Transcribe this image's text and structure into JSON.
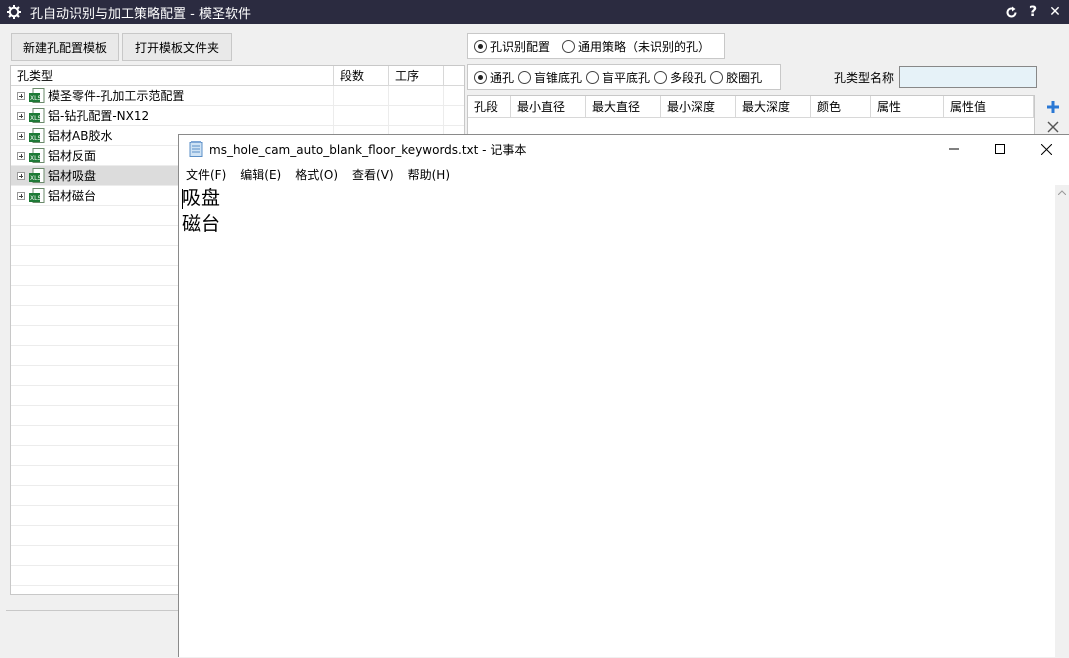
{
  "app": {
    "title": "孔自动识别与加工策略配置 - 模圣软件",
    "buttons": {
      "new_template": "新建孔配置模板",
      "open_folder": "打开模板文件夹"
    },
    "tree": {
      "headers": [
        "孔类型",
        "段数",
        "工序"
      ],
      "items": [
        {
          "label": "模圣零件-孔加工示范配置"
        },
        {
          "label": "铝-钻孔配置-NX12"
        },
        {
          "label": "铝材AB胶水"
        },
        {
          "label": "铝材反面"
        },
        {
          "label": "铝材吸盘",
          "selected": true
        },
        {
          "label": "铝材磁台"
        }
      ]
    },
    "mode": {
      "options": [
        "孔识别配置",
        "通用策略（未识别的孔）"
      ],
      "selected": 0
    },
    "hole_kind": {
      "options": [
        "通孔",
        "盲锥底孔",
        "盲平底孔",
        "多段孔",
        "胶圈孔"
      ],
      "selected": 0
    },
    "hole_name_label": "孔类型名称",
    "hole_name_value": "",
    "grid_headers": [
      "孔段",
      "最小直径",
      "最大直径",
      "最小深度",
      "最大深度",
      "颜色",
      "属性",
      "属性值"
    ]
  },
  "notepad": {
    "title": "ms_hole_cam_auto_blank_floor_keywords.txt - 记事本",
    "menu": [
      "文件(F)",
      "编辑(E)",
      "格式(O)",
      "查看(V)",
      "帮助(H)"
    ],
    "content": "吸盘\n磁台"
  },
  "colors": {
    "titlebar": "#2b2b40",
    "accent_plus": "#2a78d4",
    "xls_green": "#1e7a36"
  }
}
